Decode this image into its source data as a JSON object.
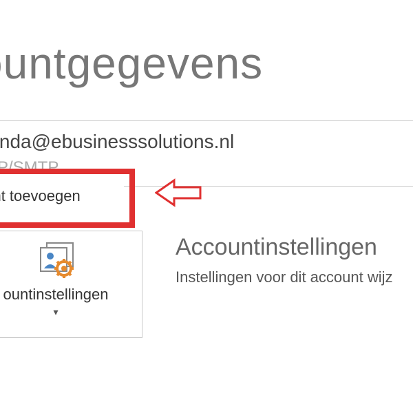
{
  "page": {
    "title": "countgegevens"
  },
  "account": {
    "email": "manda@ebusinesssolutions.nl",
    "protocol": "MAP/SMTP"
  },
  "add_account": {
    "label": "ount toevoegen"
  },
  "settings_button": {
    "label": "ountinstellingen"
  },
  "settings_panel": {
    "title": "Accountinstellingen",
    "description": "Instellingen voor dit account wijz"
  }
}
